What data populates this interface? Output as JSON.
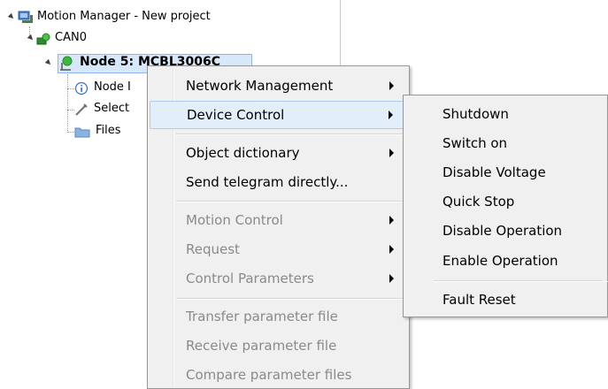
{
  "tree": {
    "root_label": "Motion Manager - New project",
    "can_label": "CAN0",
    "node_label": "Node 5: MCBL3006C",
    "children": [
      {
        "label": "Node I"
      },
      {
        "label": "Select"
      },
      {
        "label": "Files"
      }
    ]
  },
  "context_menu": {
    "items": [
      {
        "label": "Network Management",
        "submenu": true,
        "enabled": true
      },
      {
        "label": "Device Control",
        "submenu": true,
        "enabled": true,
        "highlighted": true
      },
      {
        "label": "Object dictionary",
        "submenu": true,
        "enabled": true
      },
      {
        "label": "Send telegram directly...",
        "submenu": false,
        "enabled": true
      },
      {
        "label": "Motion Control",
        "submenu": true,
        "enabled": false
      },
      {
        "label": "Request",
        "submenu": true,
        "enabled": false
      },
      {
        "label": "Control Parameters",
        "submenu": true,
        "enabled": false
      },
      {
        "label": "Transfer parameter file",
        "submenu": false,
        "enabled": false
      },
      {
        "label": "Receive parameter file",
        "submenu": false,
        "enabled": false
      },
      {
        "label": "Compare parameter files",
        "submenu": false,
        "enabled": false
      }
    ]
  },
  "device_control_submenu": {
    "items": [
      {
        "label": "Shutdown"
      },
      {
        "label": "Switch on"
      },
      {
        "label": "Disable Voltage"
      },
      {
        "label": "Quick Stop"
      },
      {
        "label": "Disable Operation"
      },
      {
        "label": "Enable Operation"
      },
      {
        "label": "Fault Reset"
      }
    ]
  },
  "colors": {
    "menu_bg": "#f0f0f0",
    "highlight_bg": "#e3eefb",
    "disabled_text": "#8a8a8a",
    "status_green": "#3cb83c"
  }
}
